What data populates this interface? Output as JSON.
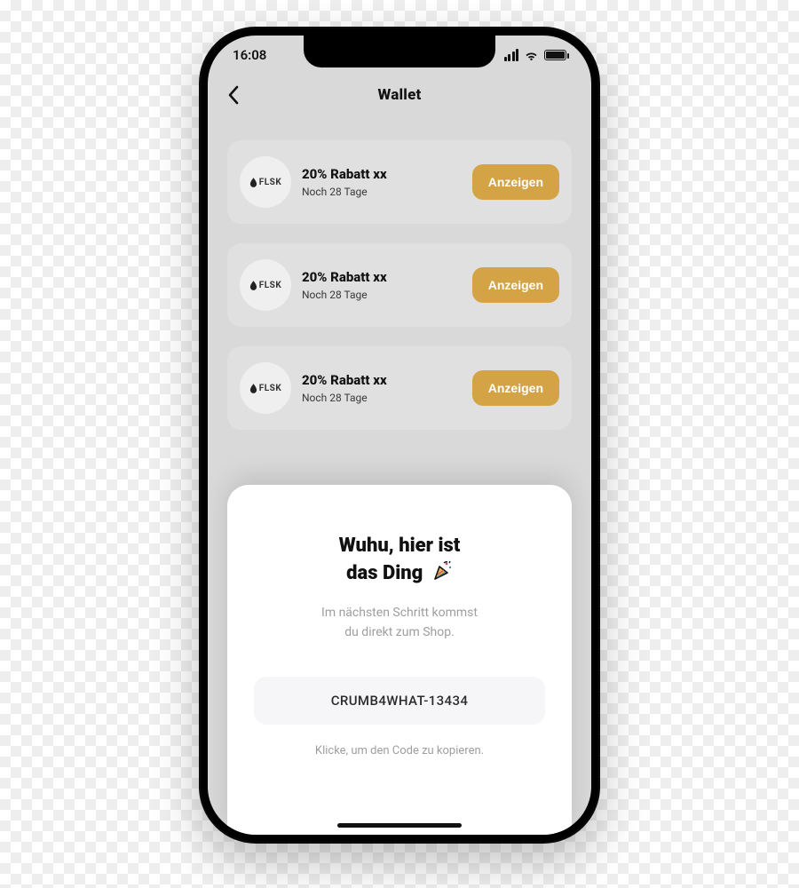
{
  "status": {
    "time": "16:08"
  },
  "nav": {
    "title": "Wallet"
  },
  "coupons": [
    {
      "brand": "FLSK",
      "title": "20% Rabatt xx",
      "sub": "Noch 28 Tage",
      "cta": "Anzeigen"
    },
    {
      "brand": "FLSK",
      "title": "20% Rabatt xx",
      "sub": "Noch 28 Tage",
      "cta": "Anzeigen"
    },
    {
      "brand": "FLSK",
      "title": "20% Rabatt xx",
      "sub": "Noch 28 Tage",
      "cta": "Anzeigen"
    }
  ],
  "modal": {
    "title_line1": "Wuhu, hier ist",
    "title_line2": "das Ding",
    "emoji": "🎉",
    "sub_line1": "Im nächsten Schritt kommst",
    "sub_line2": "du direkt zum Shop.",
    "code": "CRUMB4WHAT-13434",
    "copy_hint": "Klicke, um den Code zu kopieren."
  },
  "colors": {
    "accent": "#d4a345"
  }
}
